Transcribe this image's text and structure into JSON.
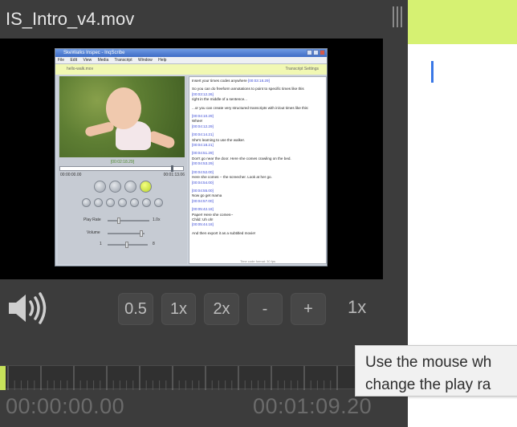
{
  "window": {
    "title": "IS_Intro_v4.mov"
  },
  "video": {
    "inner_app": {
      "title": "SkeWalks Inspec - InqScribe",
      "menu": [
        "File",
        "Edit",
        "View",
        "Media",
        "Transcript",
        "Window",
        "Help"
      ],
      "media_name": "hello-walk.mov",
      "settings_link": "Transcript Settings",
      "timecode_center": "[00:02:18.29]",
      "time_start": "00:00:00.00",
      "time_end": "00:01:13.06",
      "play_rate_label": "Play Rate",
      "play_rate_max": "1.0x",
      "volume_label": "Volume",
      "slider3_min": "1",
      "slider3_max": "8",
      "transcript": [
        {
          "ts": "",
          "text": "Insert your times codes anywhere",
          "ts_after": "[00:03:18.29]"
        },
        {
          "ts": "",
          "text": "So you can do freeform annotations to point to specific times like this",
          "ts_after": "[00:03:12.26]"
        },
        {
          "ts": "",
          "text": "right in the middle of a sentence...",
          "ts_after": ""
        },
        {
          "ts": "",
          "text": "...or you can create very structured transcripts with in/out times like this:",
          "ts_after": ""
        },
        {
          "ts": "[00:04:10.29]",
          "text": "Whee!",
          "ts_after": "[00:04:12.29]"
        },
        {
          "ts": "[00:04:14.21]",
          "text": "She's learning to use the walker.",
          "ts_after": "[00:04:18.21]"
        },
        {
          "ts": "[00:04:51.29]",
          "text": "Don't go near the door.  Here she comes crawling on the bed.",
          "ts_after": "[00:04:53.29]"
        },
        {
          "ts": "[00:04:52.00]",
          "text": "Here she comes -- the screecher.  Look at her go.",
          "ts_after": "[00:04:54.00]"
        },
        {
          "ts": "[00:04:55.00]",
          "text": "Now go get mama",
          "ts_after": "[00:04:57.00]"
        },
        {
          "ts": "[00:05:42.18]",
          "text": "Paper! Here she comes--",
          "ts_after": ""
        },
        {
          "ts": "",
          "text": "Child: Uh oh!",
          "ts_after": "[00:05:44.18]"
        },
        {
          "ts": "",
          "text": "And then export it as a subtitled movie!",
          "ts_after": ""
        }
      ],
      "status": "Time code format: 30 fps"
    }
  },
  "controls": {
    "volume_icon": "speaker-icon",
    "rate_buttons": [
      "0.5",
      "1x",
      "2x",
      "-",
      "+"
    ],
    "current_rate": "1x"
  },
  "timeline": {
    "start_time": "00:00:00.00",
    "end_time": "00:01:09.20",
    "progress": 0.014
  },
  "tooltip": {
    "line1": "Use the mouse wh",
    "line2": "change the play ra"
  },
  "colors": {
    "accent_green": "#d6f172",
    "caret_blue": "#3a78e6",
    "panel_dark": "#3c3c3c"
  }
}
